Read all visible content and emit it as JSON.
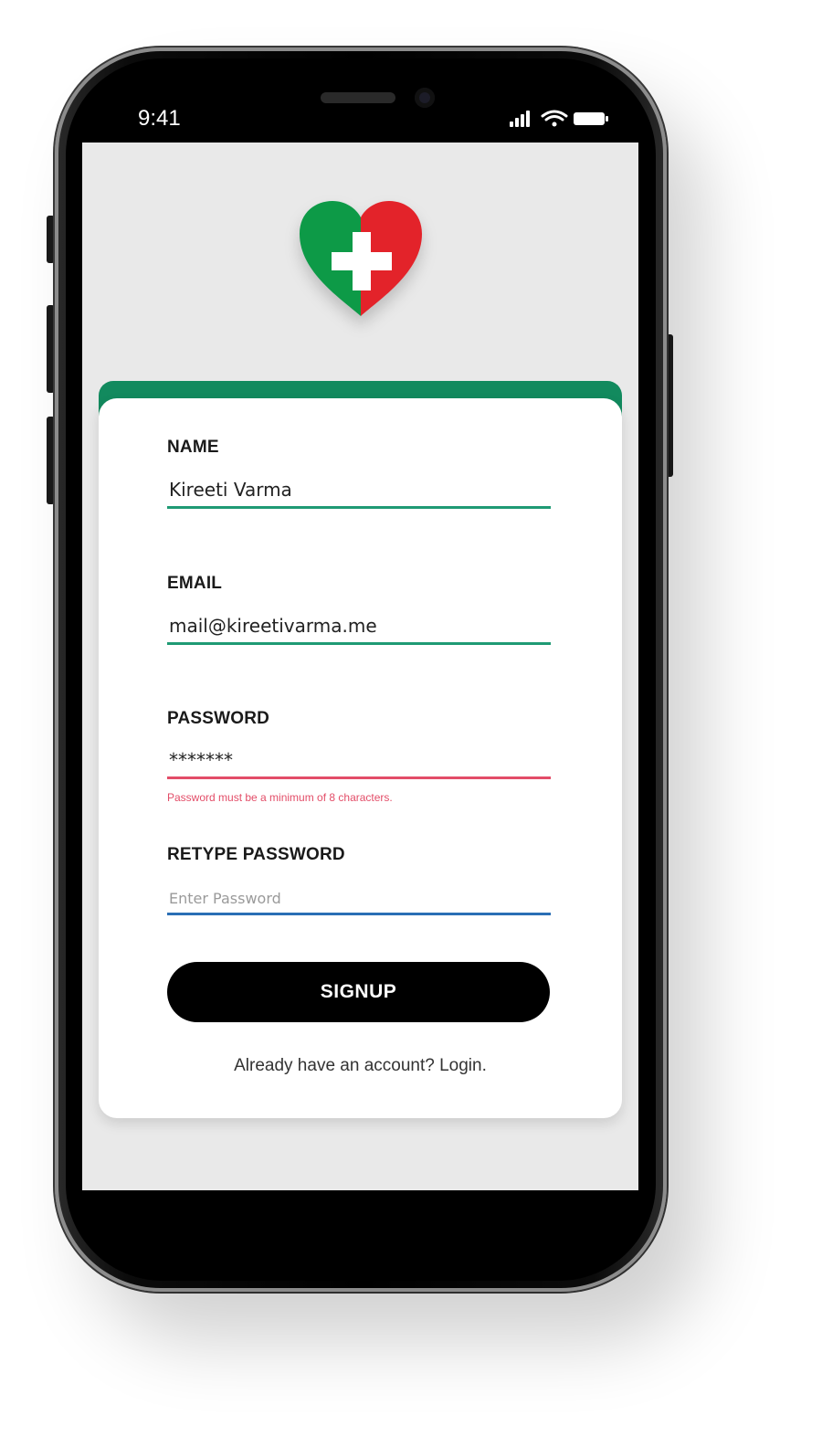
{
  "status_bar": {
    "time": "9:41"
  },
  "form": {
    "fields": [
      {
        "label": "NAME",
        "value": "Kireeti Varma",
        "placeholder": "",
        "underline_color": "#1f9a74"
      },
      {
        "label": "EMAIL",
        "value": "mail@kireetivarma.me",
        "placeholder": "",
        "underline_color": "#1f9a74"
      },
      {
        "label": "PASSWORD",
        "value": "*******",
        "placeholder": "",
        "underline_color": "#e34d68",
        "error": "Password must be a minimum of 8 characters."
      },
      {
        "label": "RETYPE PASSWORD",
        "value": "",
        "placeholder": "Enter Password",
        "underline_color": "#2a6fb5"
      }
    ],
    "submit_label": "SIGNUP",
    "login_prompt": "Already have an account? Login."
  },
  "colors": {
    "accent": "#128a5e",
    "logo_green": "#0d9a47",
    "logo_red": "#e3232a",
    "error": "#e34d68",
    "button": "#000000"
  },
  "icons": [
    "heart-cross-logo-icon",
    "signal-icon",
    "wifi-icon",
    "battery-icon"
  ]
}
